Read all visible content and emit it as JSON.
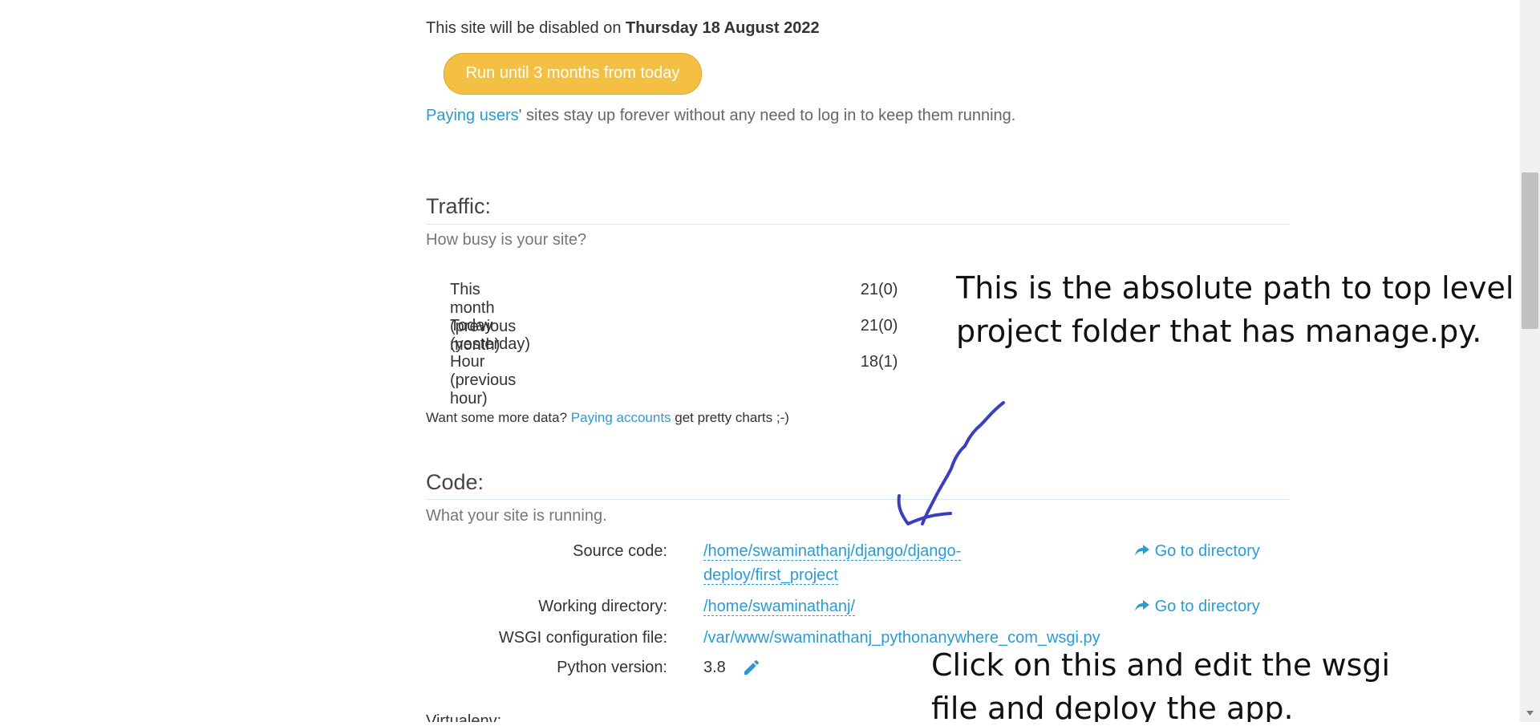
{
  "disable": {
    "prefix": "This site will be disabled on ",
    "date": "Thursday 18 August 2022"
  },
  "run_button": {
    "label": "Run until 3 months from today"
  },
  "paying_note": {
    "link": "Paying users",
    "rest": "' sites stay up forever without any need to log in to keep them running."
  },
  "traffic": {
    "title": "Traffic:",
    "subtitle": "How busy is your site?",
    "rows": [
      {
        "label": "This month (previous month)",
        "value": "21",
        "previous": "(0)"
      },
      {
        "label": "Today (yesterday)",
        "value": "21",
        "previous": "(0)"
      },
      {
        "label": "Hour (previous hour)",
        "value": "18",
        "previous": "(1)"
      }
    ],
    "more_prefix": "Want some more data? ",
    "more_link": "Paying accounts",
    "more_suffix": " get pretty charts ;-)"
  },
  "code": {
    "title": "Code:",
    "subtitle": "What your site is running.",
    "source_label": "Source code:",
    "source_line1": "/home/swaminathanj/django/django-",
    "source_line2": "deploy/first_project",
    "working_label": "Working directory:",
    "working_value": "/home/swaminathanj/",
    "wsgi_label": "WSGI configuration file:",
    "wsgi_value": "/var/www/swaminathanj_pythonanywhere_com_wsgi.py",
    "python_label": "Python version:",
    "python_value": "3.8",
    "go_to_directory": "Go to directory",
    "next_section_partial": "Virtualenv:"
  },
  "annotations": {
    "top_line1": "This is the absolute path to top level",
    "top_line2": "project folder that has manage.py.",
    "bottom_line1": "Click on this and edit the wsgi",
    "bottom_line2": "file and deploy the app."
  },
  "colors": {
    "accent": "#2b9bd1",
    "button": "#f3c043",
    "annotation_ink": "#3a3fc2"
  }
}
